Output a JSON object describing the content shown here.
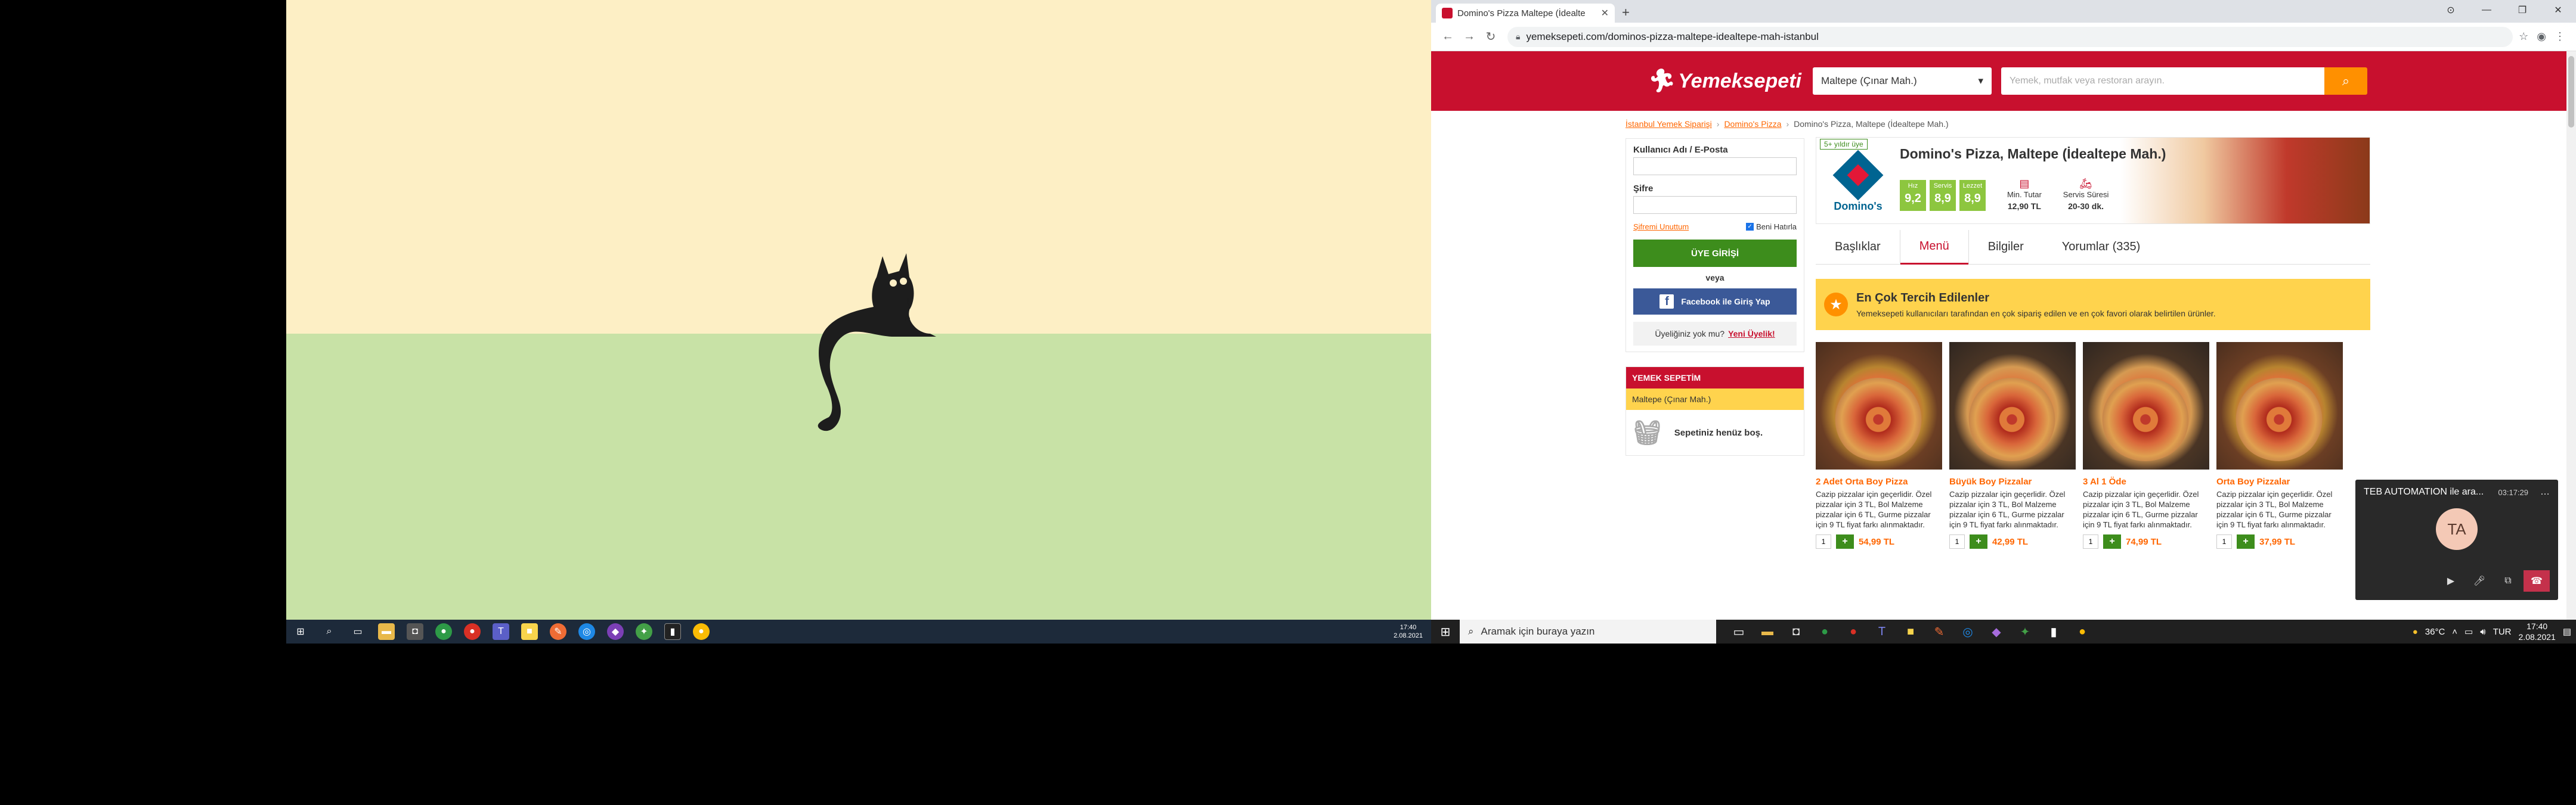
{
  "left_monitor": {
    "taskbar_time": "17:40",
    "taskbar_date": "2.08.2021"
  },
  "browser": {
    "tab_title": "Domino's Pizza Maltepe (İdealte",
    "new_tab": "+",
    "url": "yemeksepeti.com/dominos-pizza-maltepe-idealtepe-mah-istanbul"
  },
  "site": {
    "brand": "Yemeksepeti",
    "location_select": "Maltepe (Çınar Mah.)",
    "search_placeholder": "Yemek, mutfak veya restoran arayın.",
    "breadcrumb": [
      "İstanbul Yemek Siparişi",
      "Domino's Pizza",
      "Domino's Pizza, Maltepe (İdealtepe Mah.)"
    ],
    "login": {
      "user_label": "Kullanıcı Adı / E-Posta",
      "password_label": "Şifre",
      "forgot": "Şifremi Unuttum",
      "remember": "Beni Hatırla",
      "login_button": "ÜYE GİRİŞİ",
      "or": "veya",
      "facebook_button": "Facebook ile Giriş Yap",
      "no_member": "Üyeliğiniz yok mu?",
      "register": "Yeni Üyelik!"
    },
    "basket": {
      "title": "YEMEK SEPETİM",
      "location": "Maltepe (Çınar Mah.)",
      "empty": "Sepetiniz henüz boş."
    },
    "restaurant": {
      "badge": "5+ yıldır üye",
      "logo_name": "Domino's",
      "name": "Domino's Pizza, Maltepe (İdealtepe Mah.)",
      "scores": [
        {
          "label": "Hız",
          "value": "9,2"
        },
        {
          "label": "Servis",
          "value": "8,9"
        },
        {
          "label": "Lezzet",
          "value": "8,9"
        }
      ],
      "min_label": "Min. Tutar",
      "min_value": "12,90 TL",
      "service_label": "Servis Süresi",
      "service_value": "20-30 dk."
    },
    "tabs": [
      "Başlıklar",
      "Menü",
      "Bilgiler",
      "Yorumlar (335)"
    ],
    "favorites": {
      "title": "En Çok Tercih Edilenler",
      "subtitle": "Yemeksepeti kullanıcıları tarafından en çok sipariş edilen ve en çok favori olarak belirtilen ürünler."
    },
    "products": [
      {
        "title": "2 Adet Orta Boy Pizza",
        "desc": "Cazip pizzalar için geçerlidir. Özel pizzalar için 3 TL, Bol Malzeme pizzalar için 6 TL, Gurme pizzalar için 9 TL fiyat farkı alınmaktadır.",
        "qty": "1",
        "price": "54,99 TL"
      },
      {
        "title": "Büyük Boy Pizzalar",
        "desc": "Cazip pizzalar için geçerlidir. Özel pizzalar için 3 TL, Bol Malzeme pizzalar için 6 TL, Gurme pizzalar için 9 TL fiyat farkı alınmaktadır.",
        "qty": "1",
        "price": "42,99 TL"
      },
      {
        "title": "3 Al 1 Öde",
        "desc": "Cazip pizzalar için geçerlidir. Özel pizzalar için 3 TL, Bol Malzeme pizzalar için 6 TL, Gurme pizzalar için 9 TL fiyat farkı alınmaktadır.",
        "qty": "1",
        "price": "74,99 TL"
      },
      {
        "title": "Orta Boy Pizzalar",
        "desc": "Cazip pizzalar için geçerlidir. Özel pizzalar için 3 TL, Bol Malzeme pizzalar için 6 TL, Gurme pizzalar için 9 TL fiyat farkı alınmaktadır.",
        "qty": "1",
        "price": "37,99 TL"
      }
    ]
  },
  "teams": {
    "title": "TEB AUTOMATION ile ara...",
    "timer": "03:17:29",
    "initials": "TA"
  },
  "taskbar": {
    "search_placeholder": "Aramak için buraya yazın",
    "weather": "36°C",
    "lang": "TUR",
    "time": "17:40",
    "date": "2.08.2021"
  }
}
